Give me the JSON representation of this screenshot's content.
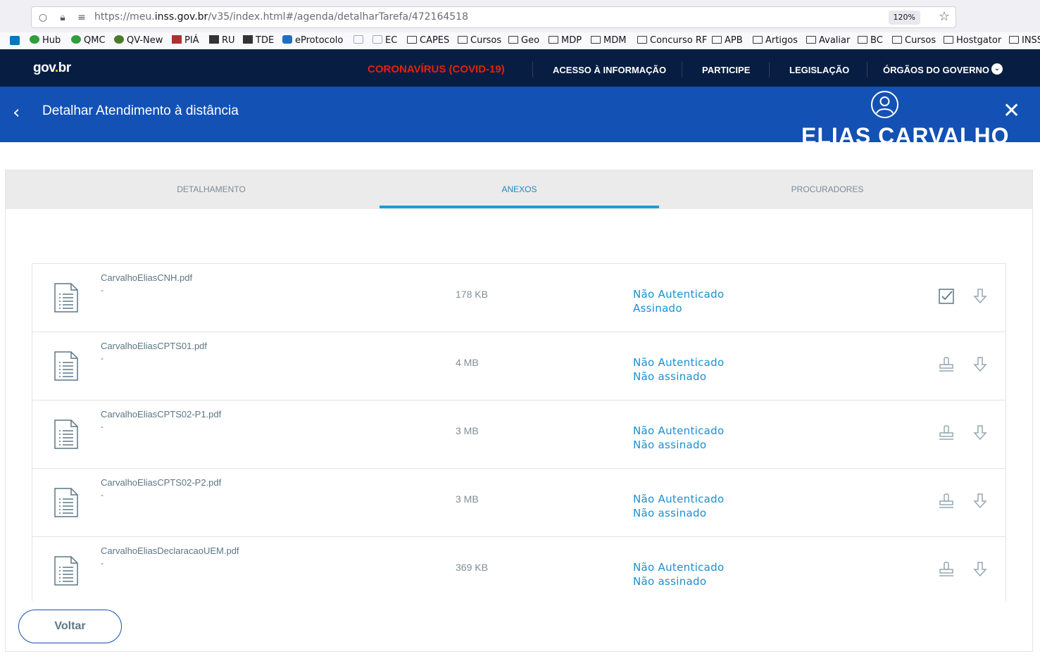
{
  "browser": {
    "url_prefix": "https://meu.",
    "url_host": "inss.gov.br",
    "url_path": "/v35/index.html#/agenda/detalharTarefa/472164518",
    "zoom": "120%"
  },
  "bookmarks": [
    {
      "label": "Hub",
      "icon": "green-dot-icon",
      "color": "#2e9e3e"
    },
    {
      "label": "QMC",
      "icon": "green-dot-icon",
      "color": "#2e9e3e"
    },
    {
      "label": "QV-New",
      "icon": "green-dot-icon",
      "color": "#4a7a2a"
    },
    {
      "label": "PIÁ",
      "icon": "crest-icon",
      "color": "#b03030"
    },
    {
      "label": "RU",
      "icon": "plane-icon",
      "color": "#333333"
    },
    {
      "label": "TDE",
      "icon": "plane-icon",
      "color": "#333333"
    },
    {
      "label": "eProtocolo",
      "icon": "blue-square-icon",
      "color": "#1e6fc0"
    },
    {
      "label": "",
      "icon": "mail-icon",
      "color": "#9aa8c8"
    },
    {
      "label": "EC",
      "icon": "mail-icon",
      "color": "#9aa8c8"
    },
    {
      "label": "CAPES",
      "icon": "folder-icon",
      "color": "#3b3b3b"
    },
    {
      "label": "Cursos",
      "icon": "folder-icon",
      "color": "#3b3b3b"
    },
    {
      "label": "Geo",
      "icon": "folder-icon",
      "color": "#3b3b3b"
    },
    {
      "label": "MDP",
      "icon": "folder-icon",
      "color": "#3b3b3b"
    },
    {
      "label": "MDM",
      "icon": "folder-icon",
      "color": "#3b3b3b"
    },
    {
      "label": "Concurso RF",
      "icon": "folder-icon",
      "color": "#3b3b3b"
    },
    {
      "label": "APB",
      "icon": "folder-icon",
      "color": "#3b3b3b"
    },
    {
      "label": "Artigos",
      "icon": "folder-icon",
      "color": "#3b3b3b"
    },
    {
      "label": "Avaliar",
      "icon": "folder-icon",
      "color": "#3b3b3b"
    },
    {
      "label": "BC",
      "icon": "folder-icon",
      "color": "#3b3b3b"
    },
    {
      "label": "Cursos",
      "icon": "folder-icon",
      "color": "#3b3b3b"
    },
    {
      "label": "Hostgator",
      "icon": "folder-icon",
      "color": "#3b3b3b"
    },
    {
      "label": "INSS",
      "icon": "folder-icon",
      "color": "#3b3b3b"
    }
  ],
  "govbar": {
    "logo_a": "gov",
    "logo_dot": ".",
    "logo_b": "br",
    "links": [
      "CORONAVÍRUS (COVID-19)",
      "ACESSO À INFORMAÇÃO",
      "PARTICIPE",
      "LEGISLAÇÃO",
      "ÓRGÃOS DO GOVERNO"
    ]
  },
  "header": {
    "title": "Detalhar Atendimento à distância",
    "user_name": "ELIAS CARVALHO"
  },
  "tabs": [
    {
      "label": "DETALHAMENTO",
      "active": false
    },
    {
      "label": "ANEXOS",
      "active": true
    },
    {
      "label": "PROCURADORES",
      "active": false
    }
  ],
  "attachments": [
    {
      "name": "CarvalhoEliasCNH.pdf",
      "description": "-",
      "size": "178 KB",
      "auth": "Não Autenticado",
      "signature": "Assinado",
      "signed": true
    },
    {
      "name": "CarvalhoEliasCPTS01.pdf",
      "description": "-",
      "size": "4 MB",
      "auth": "Não Autenticado",
      "signature": "Não assinado",
      "signed": false
    },
    {
      "name": "CarvalhoEliasCPTS02-P1.pdf",
      "description": "-",
      "size": "3 MB",
      "auth": "Não Autenticado",
      "signature": "Não assinado",
      "signed": false
    },
    {
      "name": "CarvalhoEliasCPTS02-P2.pdf",
      "description": "-",
      "size": "3 MB",
      "auth": "Não Autenticado",
      "signature": "Não assinado",
      "signed": false
    },
    {
      "name": "CarvalhoEliasDeclaracaoUEM.pdf",
      "description": "-",
      "size": "369 KB",
      "auth": "Não Autenticado",
      "signature": "Não assinado",
      "signed": false
    }
  ],
  "footer": {
    "back_label": "Voltar"
  },
  "colors": {
    "govbar": "#071d41",
    "header": "#1351b4",
    "accent": "#1a8fd0",
    "covid": "#e52207"
  }
}
